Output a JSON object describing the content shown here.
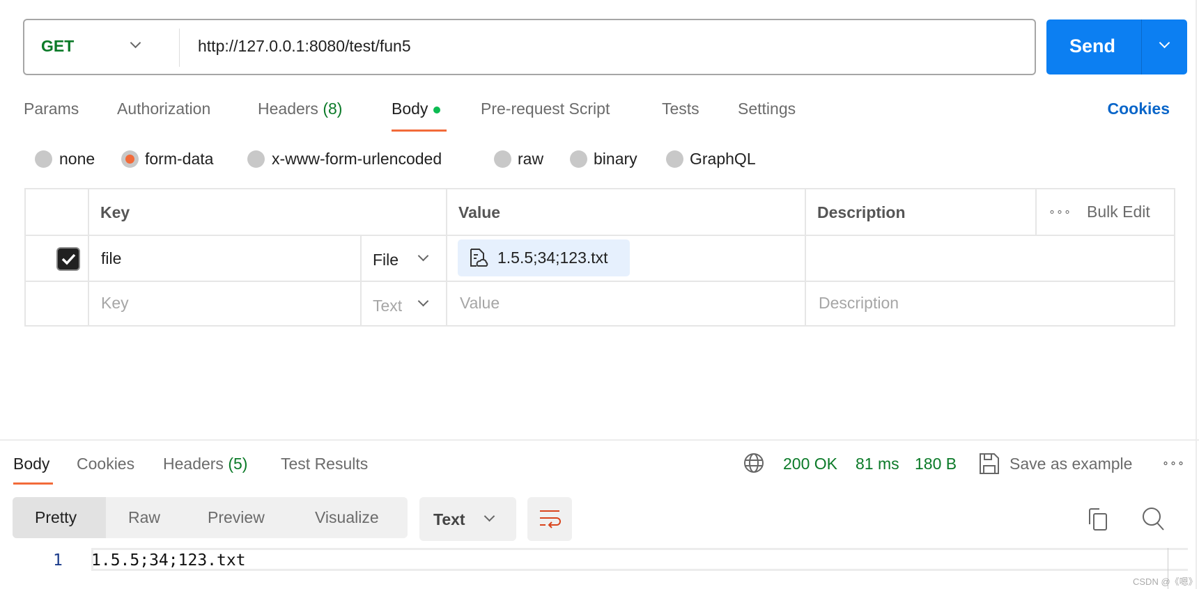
{
  "request": {
    "method": "GET",
    "url": "http://127.0.0.1:8080/test/fun5",
    "send_label": "Send"
  },
  "tabs": [
    {
      "label": "Params"
    },
    {
      "label": "Authorization"
    },
    {
      "label": "Headers",
      "count": "(8)"
    },
    {
      "label": "Body",
      "active": true
    },
    {
      "label": "Pre-request Script"
    },
    {
      "label": "Tests"
    },
    {
      "label": "Settings"
    }
  ],
  "cookies_link": "Cookies",
  "body_types": [
    {
      "label": "none"
    },
    {
      "label": "form-data",
      "selected": true
    },
    {
      "label": "x-www-form-urlencoded"
    },
    {
      "label": "raw"
    },
    {
      "label": "binary"
    },
    {
      "label": "GraphQL"
    }
  ],
  "table": {
    "headers": {
      "key": "Key",
      "value": "Value",
      "description": "Description",
      "bulk_edit": "Bulk Edit"
    },
    "rows": [
      {
        "checked": true,
        "key": "file",
        "type": "File",
        "value": "1.5.5;34;123.txt",
        "description": ""
      }
    ],
    "new_row": {
      "key_placeholder": "Key",
      "type": "Text",
      "value_placeholder": "Value",
      "description_placeholder": "Description"
    }
  },
  "response": {
    "tabs": [
      {
        "label": "Body",
        "active": true
      },
      {
        "label": "Cookies"
      },
      {
        "label": "Headers",
        "count": "(5)"
      },
      {
        "label": "Test Results"
      }
    ],
    "status": "200 OK",
    "time": "81 ms",
    "size": "180 B",
    "save_label": "Save as example",
    "views": [
      "Pretty",
      "Raw",
      "Preview",
      "Visualize"
    ],
    "format": "Text",
    "lines": [
      {
        "num": "1",
        "text": "1.5.5;34;123.txt"
      }
    ]
  },
  "watermark": "CSDN @《嗯》",
  "colors": {
    "accent": "#0c7ff2",
    "active_tab": "#f26b3a",
    "success": "#0b7a28"
  }
}
